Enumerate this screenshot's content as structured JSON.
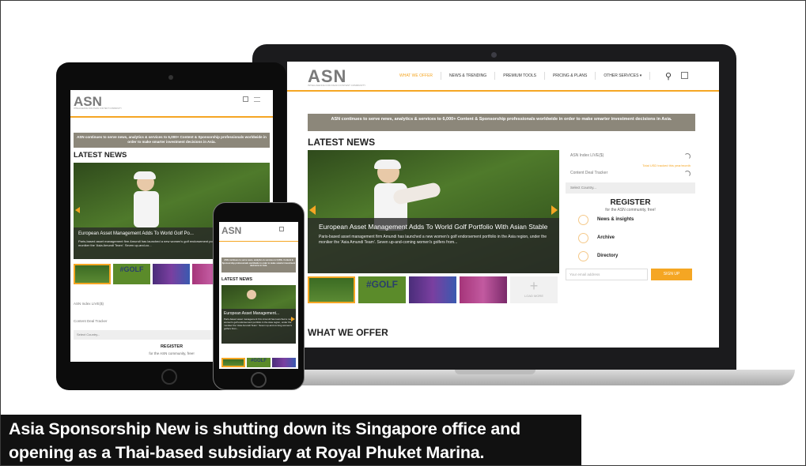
{
  "site": {
    "logo": "ASN",
    "logo_tagline": "INTELLIGENCE FOR ASIAN CONTENT COMMUNITY",
    "nav": [
      "WHAT WE OFFER",
      "NEWS & TRENDING",
      "PREMIUM TOOLS",
      "PRICING & PLANS",
      "OTHER SERVICES ▾"
    ],
    "banner": "ASN continues to serve news, analytics & services to 6,000+ Content & Sponsorship professionals worldwide in order to make smarter investment decisions in Asia.",
    "latest_news_heading": "LATEST NEWS",
    "hero": {
      "title": "European Asset Management Adds To World Golf Portfolio With Asian Stable",
      "title_short": "European Asset Management Adds To World Golf Po...",
      "phone_title": "European Asset Management...",
      "text": "Paris-based asset management firm Amundi has launched a new women's golf endorsement portfolio in the Asia region, under the moniker the 'Asia Amundi Team'. Seven up-and-coming women's golfers from...",
      "text_short": "Paris-based asset management firm Amundi has launched a new women's golf endorsement portfolio in the Asia region, under the moniker the 'Asia Amundi Team'. Seven up-and-co...",
      "text_phone": "Paris-based asset management firm Amundi has launched a new women's golf endorsement portfolio in the Asia region, under the moniker the 'Asia Amundi Team'. Seven up-and-coming women's golfers from..."
    },
    "thumb_golf_label": "#GOLF",
    "thumb_more_label": "LOAD MORE",
    "sidebar": {
      "index_label": "ASN Index LIVE($)",
      "index_note": "Total USD tracked this year/month",
      "tracker_label": "Content Deal Tracker",
      "select_placeholder": "Select Country...",
      "register_heading": "REGISTER",
      "register_sub": "for the ASN community, free!",
      "links": [
        "News & insights",
        "Archive",
        "Directory"
      ],
      "email_placeholder": "Your email address",
      "signup_label": "SIGN UP"
    },
    "what_we_offer_heading": "WHAT WE OFFER"
  },
  "caption": {
    "line1": "Asia Sponsorship New is shutting down its Singapore office and",
    "line2": "opening as a Thai-based subsidiary at Royal Phuket Marina."
  },
  "colors": {
    "accent": "#f5a623",
    "banner": "#8c877a",
    "caption_bg": "#111111"
  }
}
